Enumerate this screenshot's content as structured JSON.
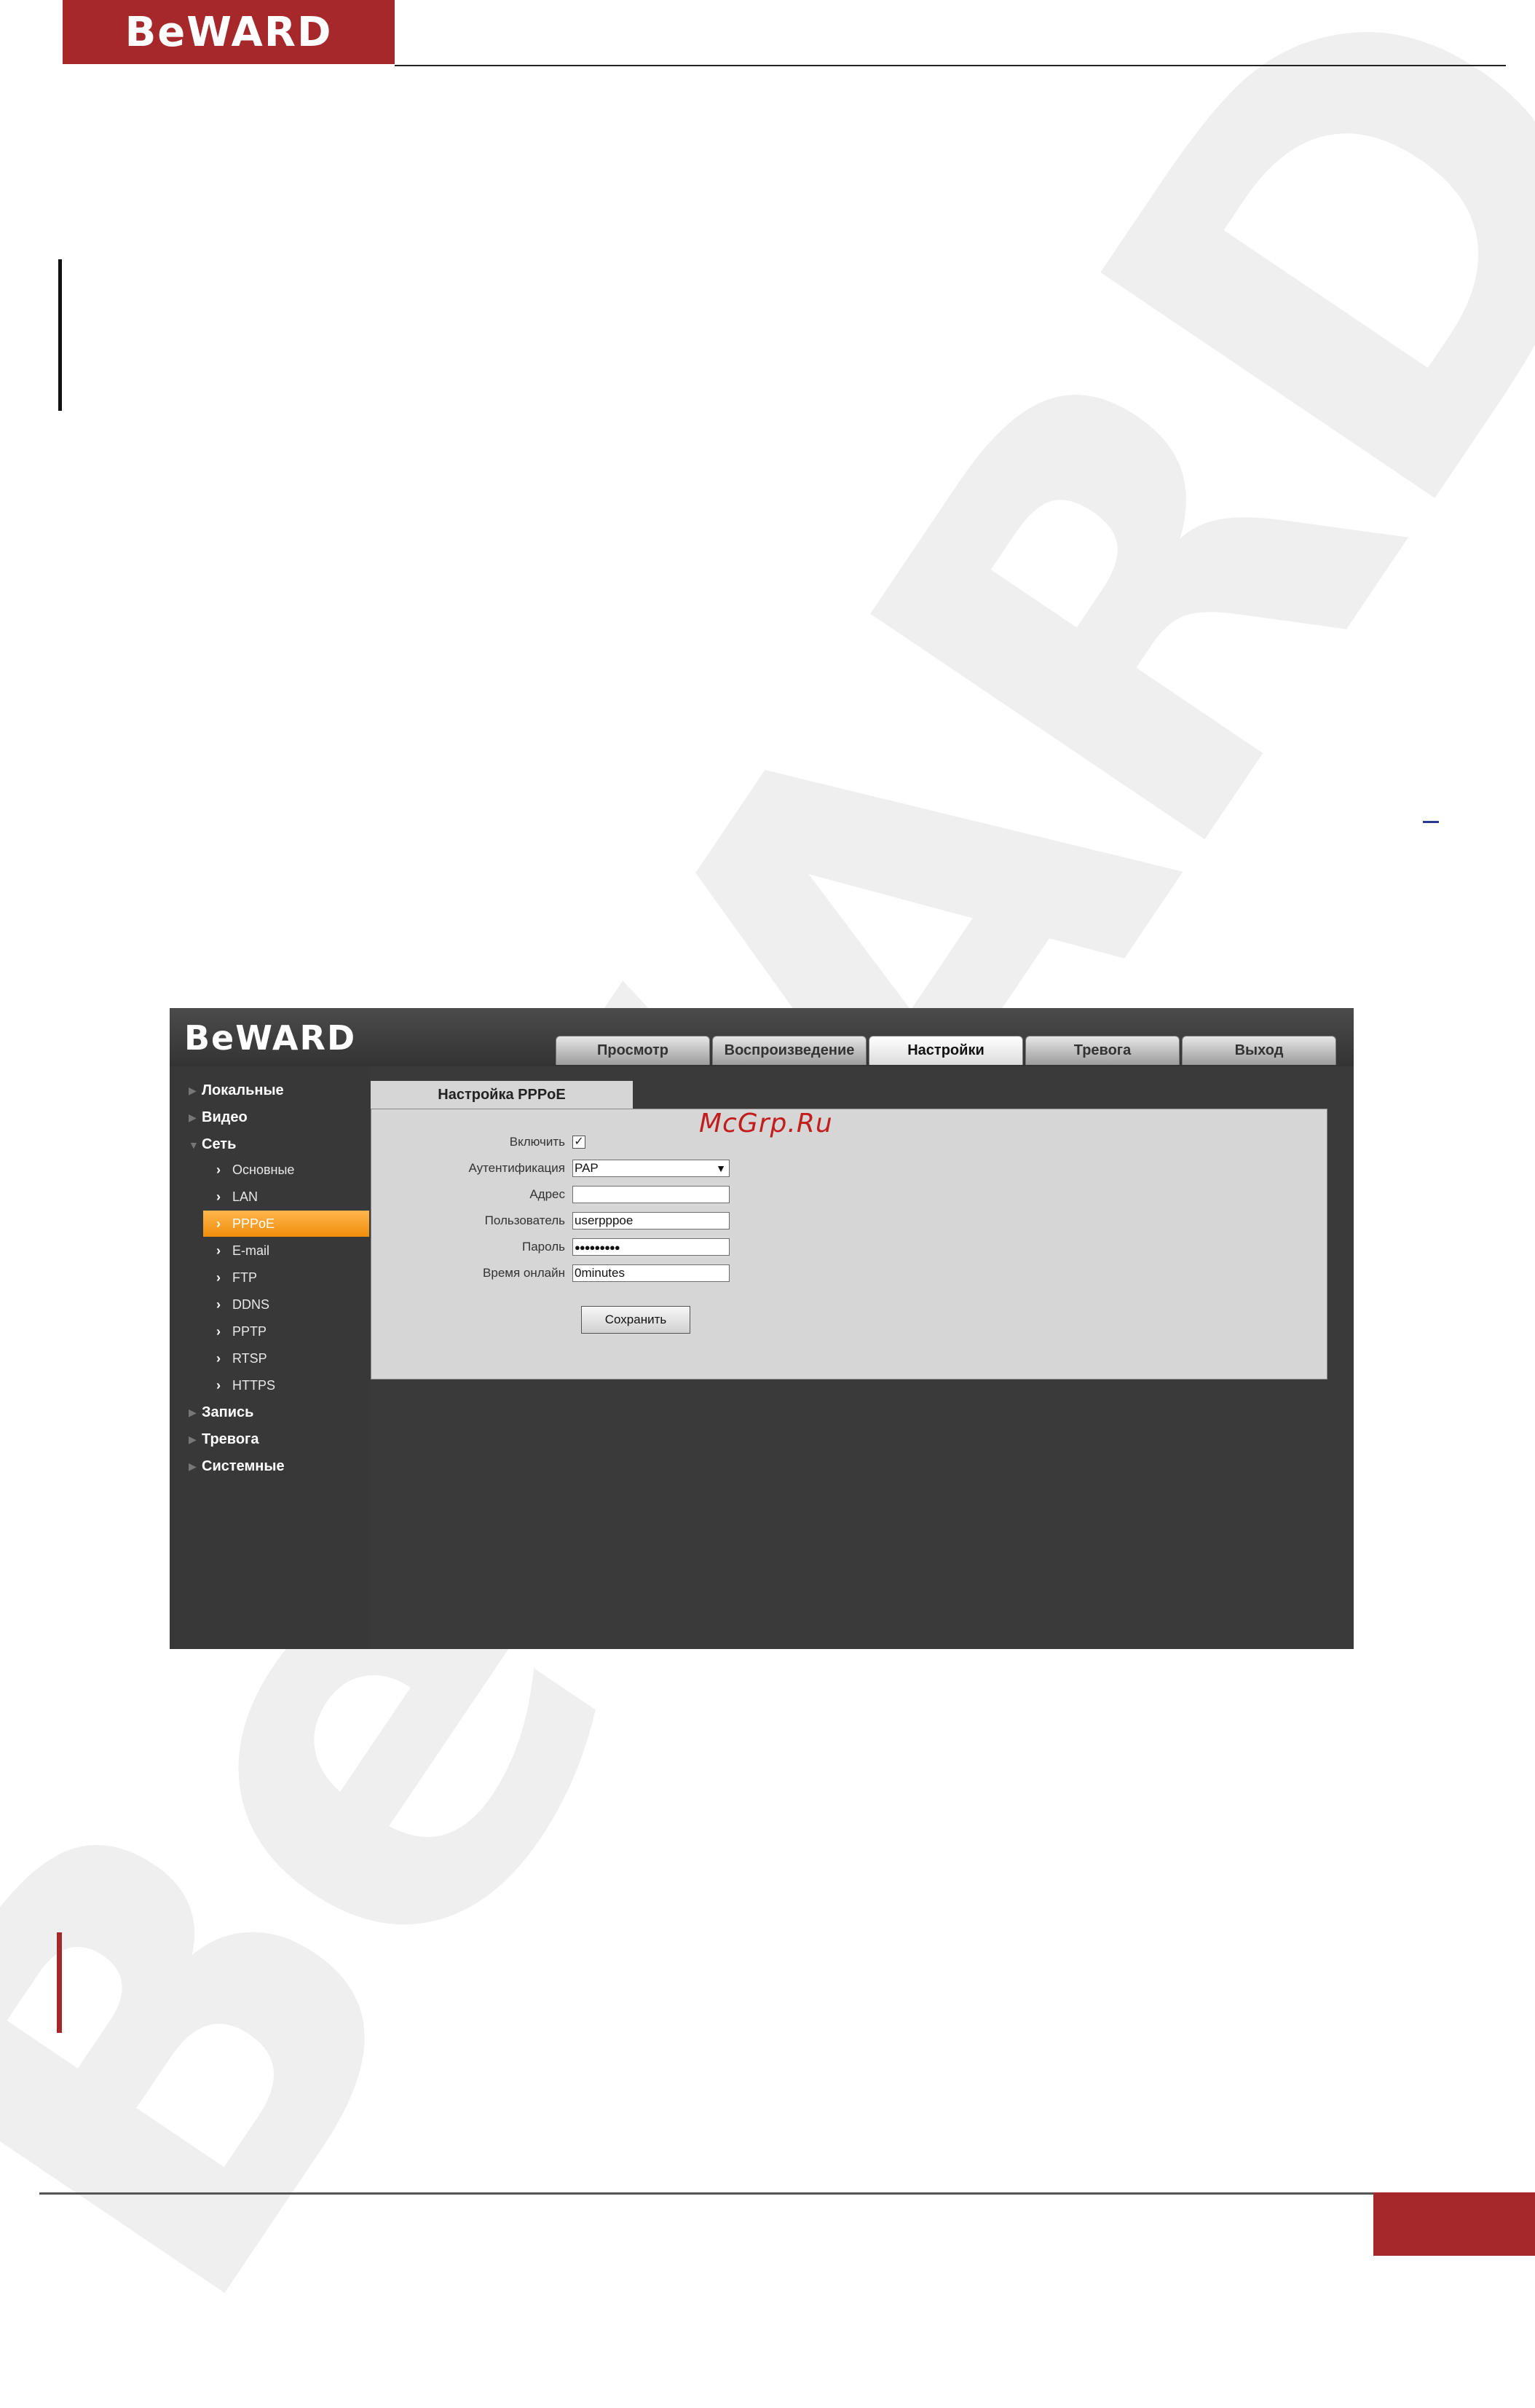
{
  "brand": {
    "logo_text": "BeWARD"
  },
  "watermark": "BeWARD",
  "site_watermark": "McGrp.Ru",
  "app": {
    "logo_text": "BeWARD",
    "tabs": [
      {
        "label": "Просмотр"
      },
      {
        "label": "Воспроизведение"
      },
      {
        "label": "Настройки",
        "active": true
      },
      {
        "label": "Тревога"
      },
      {
        "label": "Выход"
      }
    ],
    "sidebar": {
      "categories": {
        "local": "Локальные",
        "video": "Видео",
        "network": "Сеть",
        "record": "Запись",
        "alarm": "Тревога",
        "system": "Системные"
      },
      "network_items": [
        "Основные",
        "LAN",
        "PPPoE",
        "E-mail",
        "FTP",
        "DDNS",
        "PPTP",
        "RTSP",
        "HTTPS"
      ],
      "active_item": "PPPoE"
    },
    "panel": {
      "title": "Настройка PPPoE",
      "fields": {
        "enable_label": "Включить",
        "enable_checked": true,
        "auth_label": "Аутентификация",
        "auth_value": "PAP",
        "address_label": "Адрес",
        "address_value": "",
        "user_label": "Пользователь",
        "user_value": "userpppoe",
        "password_label": "Пароль",
        "password_value": "●●●●●●●●●",
        "online_label": "Время онлайн",
        "online_value": "0minutes"
      },
      "save_label": "Сохранить"
    }
  },
  "colors": {
    "brand_red": "#a6282b",
    "active_orange": "#f39a1c",
    "app_background": "#3a3a3a",
    "panel_background": "#d6d6d6"
  }
}
